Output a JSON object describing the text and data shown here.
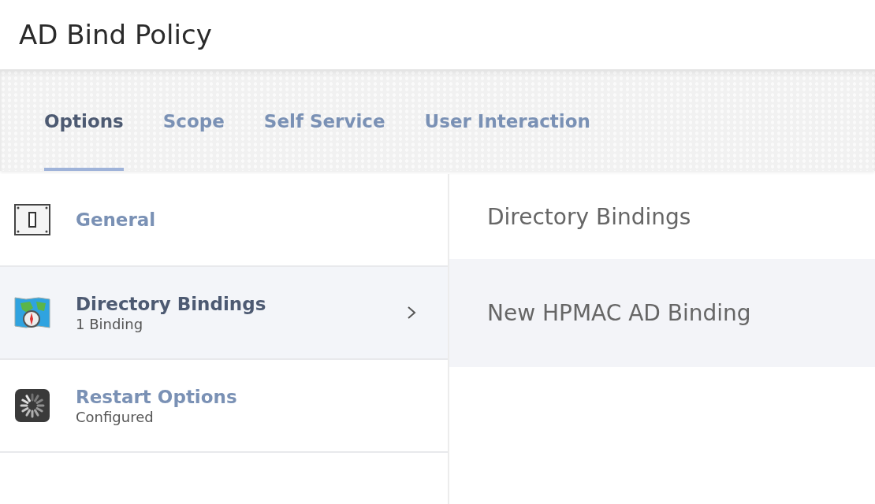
{
  "page": {
    "title": "AD Bind Policy"
  },
  "tabs": [
    {
      "label": "Options",
      "selected": true
    },
    {
      "label": "Scope",
      "selected": false
    },
    {
      "label": "Self Service",
      "selected": false
    },
    {
      "label": "User Interaction",
      "selected": false
    }
  ],
  "sidebar": {
    "items": [
      {
        "kind": "switch",
        "title": "General",
        "selected": false
      },
      {
        "kind": "map",
        "title": "Directory Bindings",
        "subtitle": "1 Binding",
        "selected": true
      },
      {
        "kind": "spinner",
        "title": "Restart Options",
        "subtitle": "Configured",
        "selected": false
      }
    ]
  },
  "detail": {
    "heading": "Directory Bindings",
    "items": [
      "New HPMAC AD Binding"
    ]
  }
}
